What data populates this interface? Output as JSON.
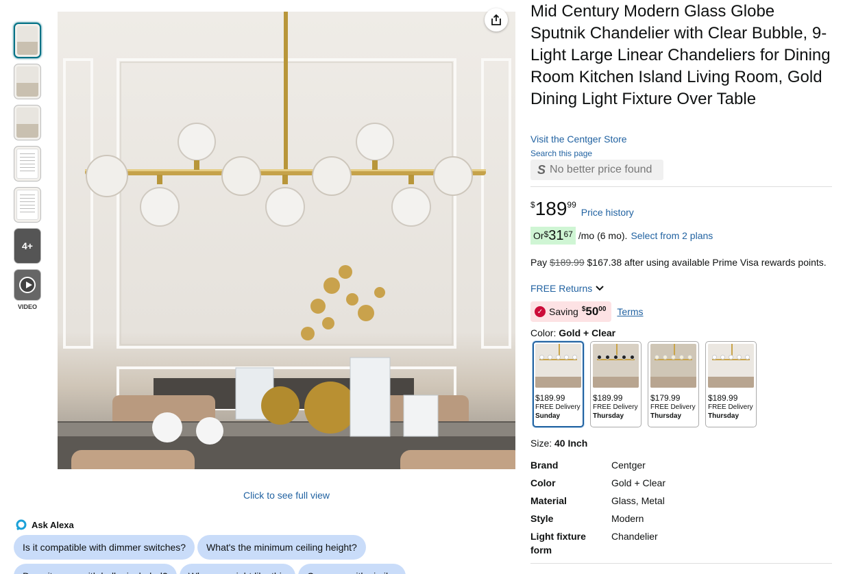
{
  "gallery": {
    "thumbnails": [
      "lifestyle",
      "lifestyle",
      "lifestyle",
      "document",
      "document"
    ],
    "more_label": "4+",
    "video_label": "VIDEO",
    "full_view_label": "Click to see full view",
    "share_icon": "share-icon"
  },
  "alexa": {
    "label": "Ask Alexa",
    "chips_row1": [
      "Is it compatible with dimmer switches?",
      "What's the minimum ceiling height?"
    ],
    "chips_row2": [
      "Does it come with bulbs included?",
      "Why you might like this",
      "Compare with similar"
    ]
  },
  "product": {
    "title": "Mid Century Modern Glass Globe Sputnik Chandelier with Clear Bubble, 9-Light Large Linear Chandeliers for Dining Room Kitchen Island Living Room, Gold Dining Light Fixture Over Table",
    "store_link": "Visit the Centger Store",
    "search_page": "Search this page",
    "no_better_price": "No better price found",
    "price": {
      "symbol": "$",
      "whole": "189",
      "fraction": "99"
    },
    "price_history": "Price history",
    "monthly": {
      "prefix": "Or ",
      "symbol": "$",
      "whole": "31",
      "fraction": "67",
      "suffix": "/mo (6 mo).",
      "plans_link": "Select from 2 plans"
    },
    "pay": {
      "prefix": "Pay ",
      "struck": "$189.99",
      "rest": " $167.38 after using available Prime Visa rewards points."
    },
    "free_returns": "FREE Returns",
    "saving": {
      "label": "Saving ",
      "symbol": "$",
      "whole": "50",
      "fraction": "00",
      "terms": "Terms"
    },
    "color": {
      "label": "Color: ",
      "value": "Gold + Clear"
    },
    "swatches": [
      {
        "price": "$189.99",
        "delivery": "FREE Delivery",
        "day": "Sunday",
        "bg": "#e9e5de",
        "selected": true
      },
      {
        "price": "$189.99",
        "delivery": "FREE Delivery",
        "day": "Thursday",
        "bg": "#d8d0c3",
        "selected": false
      },
      {
        "price": "$179.99",
        "delivery": "FREE Delivery",
        "day": "Thursday",
        "bg": "#cfc6b6",
        "selected": false
      },
      {
        "price": "$189.99",
        "delivery": "FREE Delivery",
        "day": "Thursday",
        "bg": "#ebe7e1",
        "selected": false
      }
    ],
    "size": {
      "label": "Size: ",
      "value": "40 Inch"
    },
    "specs": [
      {
        "key": "Brand",
        "value": "Centger"
      },
      {
        "key": "Color",
        "value": "Gold + Clear"
      },
      {
        "key": "Material",
        "value": "Glass, Metal"
      },
      {
        "key": "Style",
        "value": "Modern"
      },
      {
        "key": "Light fixture form",
        "value": "Chandelier"
      }
    ]
  },
  "colors": {
    "link": "#2162a1",
    "accent_green": "#cff5d4",
    "saving_bg": "#fde2e4",
    "chip_bg": "#c9dcf9"
  }
}
